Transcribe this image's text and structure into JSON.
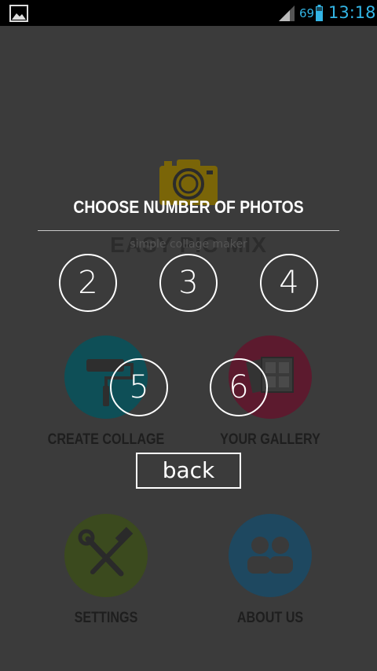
{
  "status_bar": {
    "battery_level": "69",
    "time": "13:18",
    "icons": [
      "gallery-notification-icon",
      "signal-icon",
      "battery-icon"
    ],
    "accent": "#33b5e5"
  },
  "app": {
    "title": "EASY PIC MIX",
    "subtitle": "simple collage maker",
    "menu": {
      "create_collage": {
        "label": "CREATE COLLAGE",
        "color": "#0e4f57",
        "icon": "paint-roller-icon"
      },
      "your_gallery": {
        "label": "YOUR GALLERY",
        "color": "#5c1a2e",
        "icon": "photos-icon"
      },
      "settings": {
        "label": "SETTINGS",
        "color": "#3b4a1e",
        "icon": "tools-icon"
      },
      "about_us": {
        "label": "ABOUT US",
        "color": "#1e4860",
        "icon": "people-icon"
      }
    },
    "logo_color": "#7a6508"
  },
  "dialog": {
    "title": "CHOOSE NUMBER OF PHOTOS",
    "options": [
      "2",
      "3",
      "4",
      "5",
      "6"
    ],
    "back_label": "back"
  }
}
